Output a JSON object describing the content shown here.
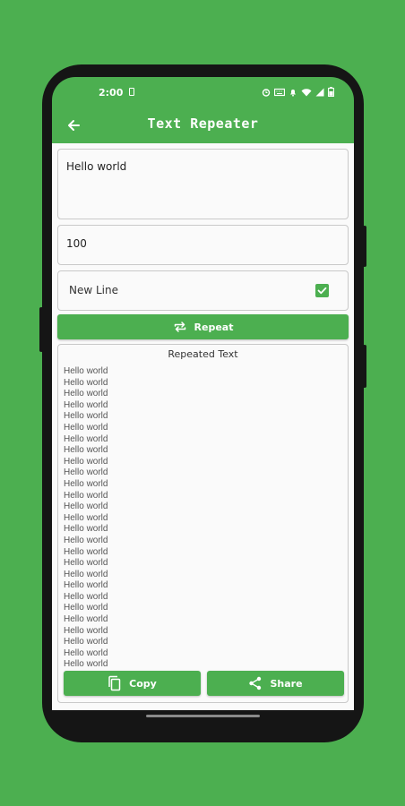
{
  "status_bar": {
    "time": "2:00",
    "icons": [
      "sim-card-icon",
      "alarm-icon",
      "keyboard-icon",
      "notifications-off-icon",
      "wifi-icon",
      "signal-icon",
      "battery-icon"
    ]
  },
  "app_bar": {
    "title": "Text Repeater",
    "back_icon": "arrow-back-icon"
  },
  "form": {
    "text_value": "Hello world",
    "count_value": "100",
    "newline_label": "New Line",
    "newline_checked": true
  },
  "repeat_button": {
    "label": "Repeat",
    "icon": "repeat-icon"
  },
  "result": {
    "title": "Repeated Text",
    "line_text": "Hello world",
    "visible_lines": 27
  },
  "copy_button": {
    "label": "Copy",
    "icon": "copy-icon"
  },
  "share_button": {
    "label": "Share",
    "icon": "share-icon"
  },
  "colors": {
    "primary": "#4caf50",
    "background": "#fafafa",
    "phone_frame": "#151515"
  }
}
